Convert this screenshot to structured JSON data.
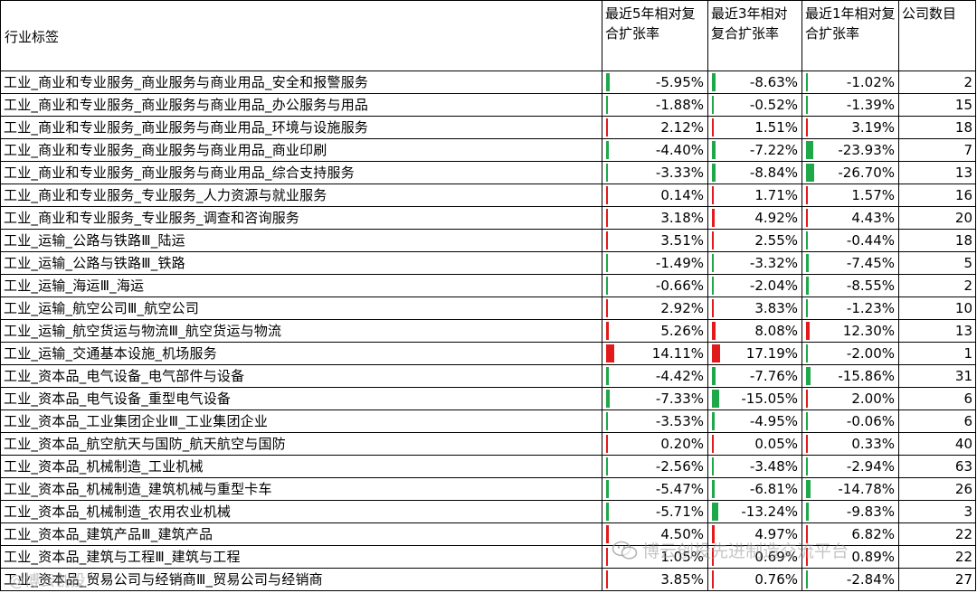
{
  "headers": {
    "category": "行业标签",
    "cagr5": "最近5年相对复合扩张率",
    "cagr3": "最近3年相对复合扩张率",
    "cagr1": "最近1年相对复合扩张率",
    "count": "公司数目"
  },
  "colors": {
    "positive": "#e11b1b",
    "negative": "#1fa84a"
  },
  "rows": [
    {
      "label": "工业_商业和专业服务_商业服务与商业用品_安全和报警服务",
      "c5": "-5.95%",
      "v5": -5.95,
      "c3": "-8.63%",
      "v3": -8.63,
      "c1": "-1.02%",
      "v1": -1.02,
      "n": "2"
    },
    {
      "label": "工业_商业和专业服务_商业服务与商业用品_办公服务与用品",
      "c5": "-1.88%",
      "v5": -1.88,
      "c3": "-0.52%",
      "v3": -0.52,
      "c1": "-1.39%",
      "v1": -1.39,
      "n": "15"
    },
    {
      "label": "工业_商业和专业服务_商业服务与商业用品_环境与设施服务",
      "c5": "2.12%",
      "v5": 2.12,
      "c3": "1.51%",
      "v3": 1.51,
      "c1": "3.19%",
      "v1": 3.19,
      "n": "18"
    },
    {
      "label": "工业_商业和专业服务_商业服务与商业用品_商业印刷",
      "c5": "-4.40%",
      "v5": -4.4,
      "c3": "-7.22%",
      "v3": -7.22,
      "c1": "-23.93%",
      "v1": -23.93,
      "n": "7"
    },
    {
      "label": "工业_商业和专业服务_商业服务与商业用品_综合支持服务",
      "c5": "-3.33%",
      "v5": -3.33,
      "c3": "-8.84%",
      "v3": -8.84,
      "c1": "-26.70%",
      "v1": -26.7,
      "n": "13"
    },
    {
      "label": "工业_商业和专业服务_专业服务_人力资源与就业服务",
      "c5": "0.14%",
      "v5": 0.14,
      "c3": "1.71%",
      "v3": 1.71,
      "c1": "1.57%",
      "v1": 1.57,
      "n": "16"
    },
    {
      "label": "工业_商业和专业服务_专业服务_调查和咨询服务",
      "c5": "3.18%",
      "v5": 3.18,
      "c3": "4.92%",
      "v3": 4.92,
      "c1": "4.43%",
      "v1": 4.43,
      "n": "20"
    },
    {
      "label": "工业_运输_公路与铁路Ⅲ_陆运",
      "c5": "3.51%",
      "v5": 3.51,
      "c3": "2.55%",
      "v3": 2.55,
      "c1": "-0.44%",
      "v1": -0.44,
      "n": "18"
    },
    {
      "label": "工业_运输_公路与铁路Ⅲ_铁路",
      "c5": "-1.49%",
      "v5": -1.49,
      "c3": "-3.32%",
      "v3": -3.32,
      "c1": "-7.45%",
      "v1": -7.45,
      "n": "5"
    },
    {
      "label": "工业_运输_海运Ⅲ_海运",
      "c5": "-0.66%",
      "v5": -0.66,
      "c3": "-2.04%",
      "v3": -2.04,
      "c1": "-8.55%",
      "v1": -8.55,
      "n": "2"
    },
    {
      "label": "工业_运输_航空公司Ⅲ_航空公司",
      "c5": "2.92%",
      "v5": 2.92,
      "c3": "3.83%",
      "v3": 3.83,
      "c1": "-1.23%",
      "v1": -1.23,
      "n": "10"
    },
    {
      "label": "工业_运输_航空货运与物流Ⅲ_航空货运与物流",
      "c5": "5.26%",
      "v5": 5.26,
      "c3": "8.08%",
      "v3": 8.08,
      "c1": "12.30%",
      "v1": 12.3,
      "n": "13"
    },
    {
      "label": "工业_运输_交通基本设施_机场服务",
      "c5": "14.11%",
      "v5": 14.11,
      "c3": "17.19%",
      "v3": 17.19,
      "c1": "-2.00%",
      "v1": -2.0,
      "n": "1"
    },
    {
      "label": "工业_资本品_电气设备_电气部件与设备",
      "c5": "-4.42%",
      "v5": -4.42,
      "c3": "-7.76%",
      "v3": -7.76,
      "c1": "-15.86%",
      "v1": -15.86,
      "n": "31"
    },
    {
      "label": "工业_资本品_电气设备_重型电气设备",
      "c5": "-7.33%",
      "v5": -7.33,
      "c3": "-15.05%",
      "v3": -15.05,
      "c1": "2.00%",
      "v1": 2.0,
      "n": "6"
    },
    {
      "label": "工业_资本品_工业集团企业Ⅲ_工业集团企业",
      "c5": "-3.53%",
      "v5": -3.53,
      "c3": "-4.95%",
      "v3": -4.95,
      "c1": "-0.06%",
      "v1": -0.06,
      "n": "6"
    },
    {
      "label": "工业_资本品_航空航天与国防_航天航空与国防",
      "c5": "0.20%",
      "v5": 0.2,
      "c3": "0.05%",
      "v3": 0.05,
      "c1": "0.33%",
      "v1": 0.33,
      "n": "40"
    },
    {
      "label": "工业_资本品_机械制造_工业机械",
      "c5": "-2.56%",
      "v5": -2.56,
      "c3": "-3.48%",
      "v3": -3.48,
      "c1": "-2.94%",
      "v1": -2.94,
      "n": "63"
    },
    {
      "label": "工业_资本品_机械制造_建筑机械与重型卡车",
      "c5": "-5.47%",
      "v5": -5.47,
      "c3": "-6.81%",
      "v3": -6.81,
      "c1": "-14.78%",
      "v1": -14.78,
      "n": "26"
    },
    {
      "label": "工业_资本品_机械制造_农用农业机械",
      "c5": "-5.71%",
      "v5": -5.71,
      "c3": "-13.24%",
      "v3": -13.24,
      "c1": "-9.83%",
      "v1": -9.83,
      "n": "3"
    },
    {
      "label": "工业_资本品_建筑产品Ⅲ_建筑产品",
      "c5": "4.50%",
      "v5": 4.5,
      "c3": "4.97%",
      "v3": 4.97,
      "c1": "6.82%",
      "v1": 6.82,
      "n": "22"
    },
    {
      "label": "工业_资本品_建筑与工程Ⅲ_建筑与工程",
      "c5": "1.05%",
      "v5": 1.05,
      "c3": "0.69%",
      "v3": 0.69,
      "c1": "0.89%",
      "v1": 0.89,
      "n": "22"
    },
    {
      "label": "工业_资本品_贸易公司与经销商Ⅲ_贸易公司与经销商",
      "c5": "3.85%",
      "v5": 3.85,
      "c3": "0.76%",
      "v3": 0.76,
      "c1": "-2.84%",
      "v1": -2.84,
      "n": "27"
    }
  ],
  "watermarks": {
    "right": "博云创投先进制造交流平台",
    "left": "@博云创投"
  }
}
